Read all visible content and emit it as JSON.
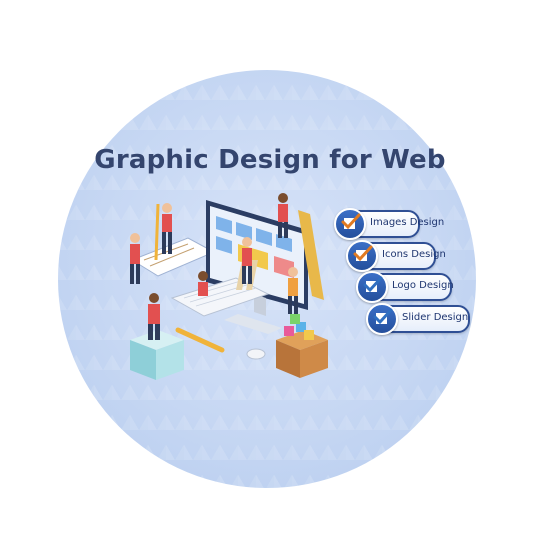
{
  "title": "Graphic Design for Web",
  "tags": [
    {
      "label": "Images Design"
    },
    {
      "label": "Icons Design"
    },
    {
      "label": "Logo Design"
    },
    {
      "label": "Slider Design"
    }
  ],
  "colors": {
    "title": "#34456e",
    "circle": "#c6d7f3",
    "tag_border": "#2f4f94",
    "check": "#e07a22"
  },
  "icons": [
    "checkbox-icon"
  ]
}
